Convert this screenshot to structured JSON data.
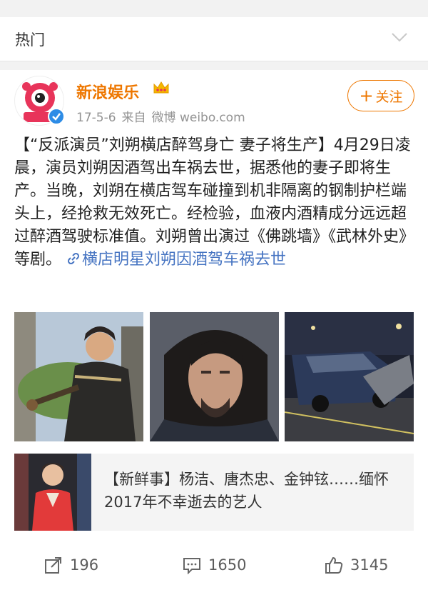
{
  "section": {
    "title": "热门"
  },
  "post": {
    "author": "新浪娱乐",
    "date": "17-5-6",
    "source_prefix": "来自",
    "source": "微博 weibo.com",
    "follow_label": "关注",
    "text": "【“反派演员”刘朔横店醉驾身亡 妻子将生产】4月29日凌晨，演员刘朔因酒驾出车祸去世，据悉他的妻子即将生产。当晚，刘朔在横店驾车碰撞到机非隔离的钢制护栏端头上，经抢救无效死亡。经检验，血液内酒精成分远远超过醉酒驾驶标准值。刘朔曾出演过《佛跳墙》《武林外史》等剧。",
    "link_text": "横店明星刘朔因酒驾车祸去世",
    "photos": [
      {
        "name": "photo-actor-costume"
      },
      {
        "name": "photo-actor-portrait"
      },
      {
        "name": "photo-crash-scene"
      }
    ],
    "repost": {
      "text": "【新鲜事】杨洁、唐杰忠、金钟铉……缅怀2017年不幸逝去的艺人"
    },
    "actions": {
      "repost_count": "196",
      "comment_count": "1650",
      "like_count": "3145"
    }
  },
  "colors": {
    "accent": "#ee7700",
    "link": "#4674c2",
    "verified": "#2d8ce6"
  }
}
